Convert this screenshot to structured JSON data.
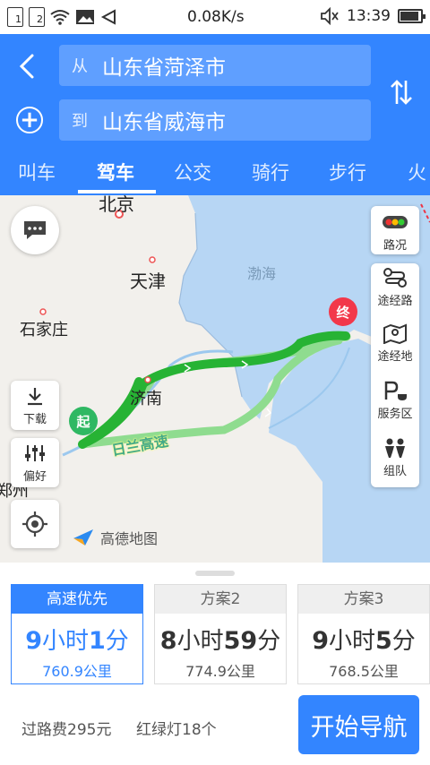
{
  "status_bar": {
    "sim1": "1",
    "sim2": "2",
    "speed": "0.08K/s",
    "time": "13:39"
  },
  "header": {
    "from_prefix": "从",
    "from_value": "山东省菏泽市",
    "to_prefix": "到",
    "to_value": "山东省威海市",
    "add_symbol": "+",
    "tabs": [
      {
        "label": "叫车"
      },
      {
        "label": "驾车"
      },
      {
        "label": "公交"
      },
      {
        "label": "骑行"
      },
      {
        "label": "步行"
      },
      {
        "label": "火"
      }
    ],
    "active_tab": "驾车"
  },
  "map": {
    "cities": {
      "beijing": "北京",
      "tianjin": "天津",
      "shijiazhuang": "石家庄",
      "jinan": "济南",
      "zhengzhou": "郑州"
    },
    "sea": "渤海",
    "road_label": "日兰高速",
    "start_marker": "起",
    "end_marker": "终",
    "logo_text": "高德地图",
    "buttons": {
      "download": "下载",
      "preference": "偏好",
      "traffic": "路况"
    },
    "side_panel": [
      {
        "label": "途经路",
        "icon": "waypoint-road-icon"
      },
      {
        "label": "途经地",
        "icon": "waypoint-place-icon"
      },
      {
        "label": "服务区",
        "icon": "service-area-icon"
      },
      {
        "label": "组队",
        "icon": "team-icon"
      }
    ],
    "colors": {
      "route_primary": "#27b334",
      "route_secondary": "#8fdc8f",
      "accent": "#3385ff"
    }
  },
  "routes": [
    {
      "name": "高速优先",
      "hours": "9",
      "h_unit": "小时",
      "minutes": "1",
      "m_unit": "分",
      "distance": "760.9公里",
      "selected": true
    },
    {
      "name": "方案2",
      "hours": "8",
      "h_unit": "小时",
      "minutes": "59",
      "m_unit": "分",
      "distance": "774.9公里",
      "selected": false
    },
    {
      "name": "方案3",
      "hours": "9",
      "h_unit": "小时",
      "minutes": "5",
      "m_unit": "分",
      "distance": "768.5公里",
      "selected": false
    }
  ],
  "summary": {
    "toll": "过路费295元",
    "lights": "红绿灯18个",
    "start_nav": "开始导航"
  }
}
